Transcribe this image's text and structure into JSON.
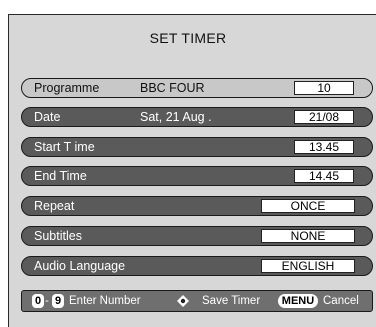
{
  "screen": {
    "title": "SET TIMER"
  },
  "rows": [
    {
      "label": "Programme",
      "extra": "BBC FOUR",
      "value": "10"
    },
    {
      "label": "Date",
      "extra": "Sat, 21 Aug .",
      "value": "21/08"
    },
    {
      "label": "Start T ime",
      "extra": "",
      "value": "13.45"
    },
    {
      "label": "End Time",
      "extra": "",
      "value": "14.45"
    },
    {
      "label": "Repeat",
      "extra": "",
      "value": "ONCE"
    },
    {
      "label": "Subtitles",
      "extra": "",
      "value": "NONE"
    },
    {
      "label": "Audio Language",
      "extra": "",
      "value": "ENGLISH"
    }
  ],
  "footer": {
    "key_from": "0",
    "dash": "-",
    "key_to": "9",
    "enter_number": "Enter Number",
    "save_timer": "Save Timer",
    "menu_key": "MENU",
    "cancel": "Cancel"
  },
  "icons": {
    "ok": "ok-dot-icon"
  }
}
